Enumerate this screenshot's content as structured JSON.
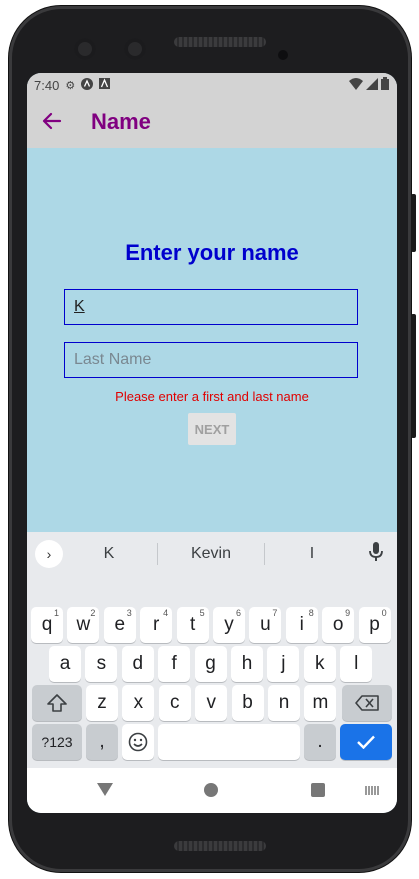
{
  "status": {
    "time": "7:40"
  },
  "appbar": {
    "title": "Name",
    "back_icon": "arrow-left-icon"
  },
  "form": {
    "heading": "Enter your name",
    "first_name_value": "K",
    "last_name_placeholder": "Last Name",
    "error": "Please enter a first and last name",
    "next_label": "NEXT"
  },
  "keyboard": {
    "suggestions": [
      "K",
      "Kevin",
      "I"
    ],
    "row1": [
      {
        "k": "q",
        "n": "1"
      },
      {
        "k": "w",
        "n": "2"
      },
      {
        "k": "e",
        "n": "3"
      },
      {
        "k": "r",
        "n": "4"
      },
      {
        "k": "t",
        "n": "5"
      },
      {
        "k": "y",
        "n": "6"
      },
      {
        "k": "u",
        "n": "7"
      },
      {
        "k": "i",
        "n": "8"
      },
      {
        "k": "o",
        "n": "9"
      },
      {
        "k": "p",
        "n": "0"
      }
    ],
    "row2": [
      "a",
      "s",
      "d",
      "f",
      "g",
      "h",
      "j",
      "k",
      "l"
    ],
    "row3": [
      "z",
      "x",
      "c",
      "v",
      "b",
      "n",
      "m"
    ],
    "symbols_label": "?123",
    "comma_label": ",",
    "period_label": "."
  },
  "colors": {
    "accent": "#800080",
    "heading": "#0000cd",
    "error": "#e00000",
    "background": "#add8e6"
  }
}
